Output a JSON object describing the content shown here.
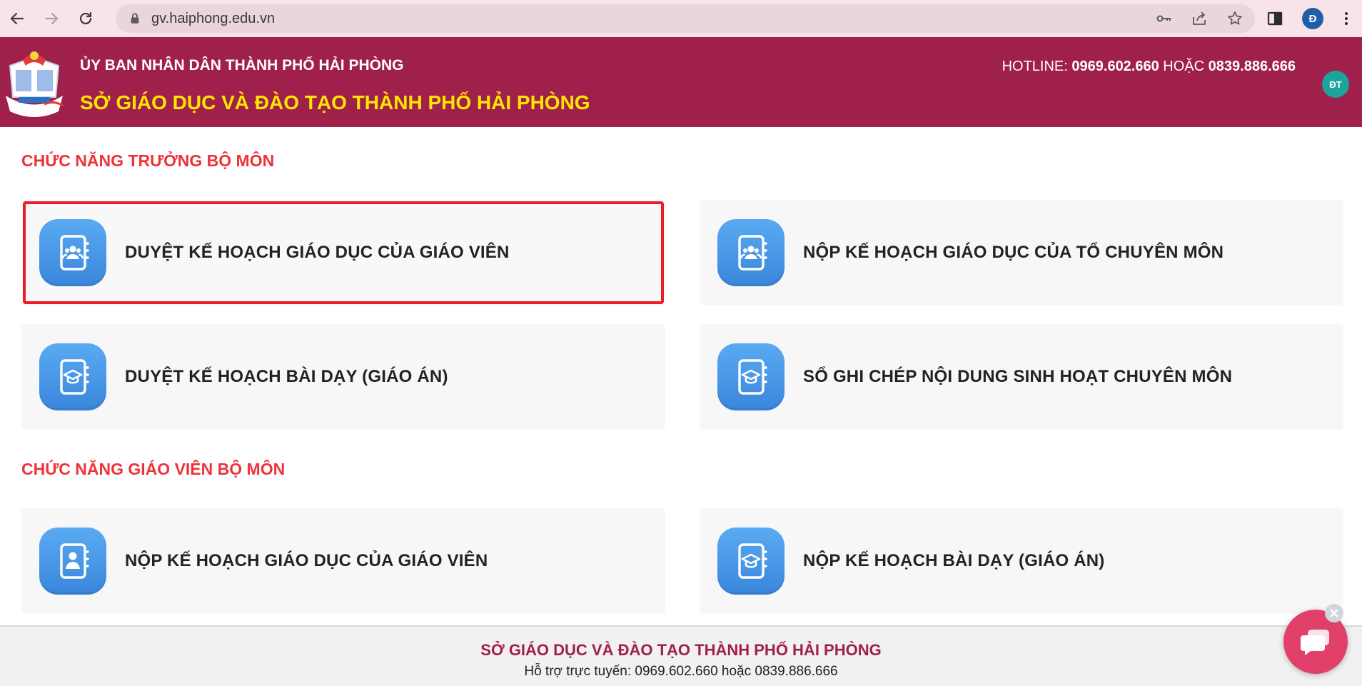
{
  "browser": {
    "url": "gv.haiphong.edu.vn",
    "profile_initial": "Đ"
  },
  "header": {
    "top_line": "ỦY BAN NHÂN DÂN THÀNH PHỐ HẢI PHÒNG",
    "main_title": "SỞ GIÁO DỤC VÀ ĐÀO TẠO THÀNH PHỐ HẢI PHÒNG",
    "hotline_label": "HOTLINE:",
    "hotline_1": "0969.602.660",
    "hotline_or": "HOẶC",
    "hotline_2": "0839.886.666",
    "user_initials": "ĐT"
  },
  "sections": [
    {
      "title": "CHỨC NĂNG TRƯỞNG BỘ MÔN",
      "cards": [
        {
          "label": "DUYỆT KẾ HOẠCH GIÁO DỤC CỦA GIÁO VIÊN",
          "icon": "group-notebook-icon",
          "selected": true
        },
        {
          "label": "NỘP KẾ HOẠCH GIÁO DỤC CỦA TỔ CHUYÊN MÔN",
          "icon": "group-notebook-icon",
          "selected": false
        },
        {
          "label": "DUYỆT KẾ HOẠCH BÀI DẠY (GIÁO ÁN)",
          "icon": "graduation-notebook-icon",
          "selected": false
        },
        {
          "label": "SỔ GHI CHÉP NỘI DUNG SINH HOẠT CHUYÊN MÔN",
          "icon": "graduation-notebook-icon",
          "selected": false
        }
      ]
    },
    {
      "title": "CHỨC NĂNG GIÁO VIÊN BỘ MÔN",
      "cards": [
        {
          "label": "NỘP KẾ HOẠCH GIÁO DỤC CỦA GIÁO VIÊN",
          "icon": "person-notebook-icon",
          "selected": false
        },
        {
          "label": "NỘP KẾ HOẠCH BÀI DẠY (GIÁO ÁN)",
          "icon": "graduation-notebook-icon",
          "selected": false
        }
      ]
    }
  ],
  "footer": {
    "title": "SỞ GIÁO DỤC VÀ ĐÀO TẠO THÀNH PHỐ HẢI PHÒNG",
    "support": "Hỗ trợ trực tuyến: 0969.602.660 hoặc 0839.886.666"
  },
  "colors": {
    "header_bg": "#a0204c",
    "header_title": "#ffe600",
    "section_title": "#ee3338",
    "tile_blue": "#4a96e6",
    "selection_border": "#ee1c24"
  }
}
